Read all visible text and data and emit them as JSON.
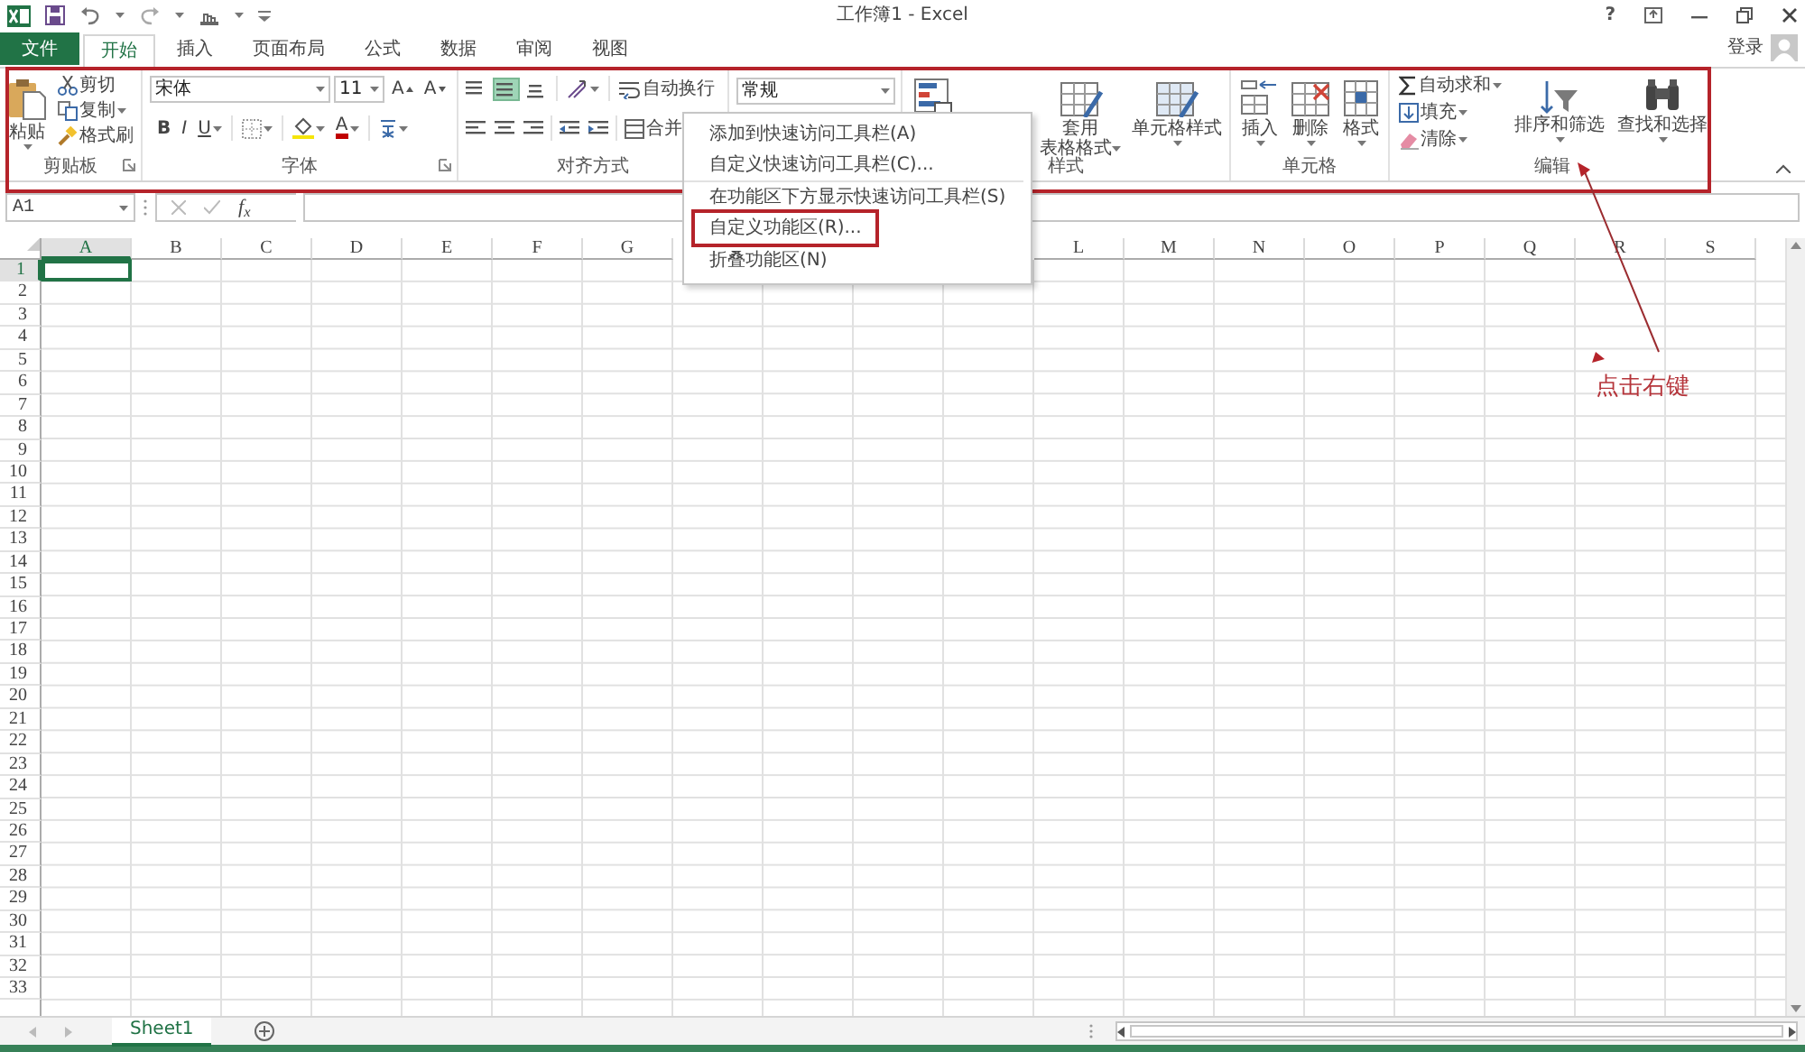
{
  "title_bar": {
    "title": "工作簿1 - Excel",
    "help": "?"
  },
  "tabs": [
    {
      "label": "文件",
      "kind": "file",
      "selected": false
    },
    {
      "label": "开始",
      "kind": "tab",
      "selected": true
    },
    {
      "label": "插入",
      "kind": "tab",
      "selected": false
    },
    {
      "label": "页面布局",
      "kind": "tab",
      "selected": false
    },
    {
      "label": "公式",
      "kind": "tab",
      "selected": false
    },
    {
      "label": "数据",
      "kind": "tab",
      "selected": false
    },
    {
      "label": "审阅",
      "kind": "tab",
      "selected": false
    },
    {
      "label": "视图",
      "kind": "tab",
      "selected": false
    }
  ],
  "account": {
    "sign_in": "登录"
  },
  "ribbon": {
    "clipboard": {
      "label": "剪贴板",
      "paste": "粘贴",
      "cut": "剪切",
      "copy": "复制",
      "format_painter": "格式刷"
    },
    "font": {
      "label": "字体",
      "font_name": "宋体",
      "font_size": "11",
      "grow": "A",
      "shrink": "A",
      "bold": "B",
      "italic": "I",
      "underline": "U",
      "font_color": "A"
    },
    "alignment": {
      "label": "对齐方式",
      "vertical": [
        {
          "kind": "top",
          "selected": false
        },
        {
          "kind": "middle",
          "selected": true
        },
        {
          "kind": "bottom",
          "selected": false
        }
      ],
      "wrap_text": "自动换行",
      "merge": "合并"
    },
    "number": {
      "format": "常规"
    },
    "styles": {
      "label": "样式",
      "format_as_table": [
        "套用",
        "表格格式"
      ],
      "cell_styles": "单元格样式"
    },
    "cells": {
      "label": "单元格",
      "insert": "插入",
      "delete": "删除",
      "format": "格式"
    },
    "editing": {
      "label": "编辑",
      "autosum": "自动求和",
      "fill": "填充",
      "clear": "清除",
      "sort_filter": "排序和筛选",
      "find_select": "查找和选择"
    }
  },
  "formula_bar": {
    "name_box": "A1",
    "function_label": "f$_{x}$"
  },
  "grid": {
    "columns_left": [
      {
        "label": "A",
        "selected": true
      },
      {
        "label": "B",
        "selected": false
      },
      {
        "label": "C",
        "selected": false
      },
      {
        "label": "D",
        "selected": false
      },
      {
        "label": "E",
        "selected": false
      },
      {
        "label": "F",
        "selected": false
      },
      {
        "label": "G",
        "selected": false
      }
    ],
    "columns_right": [
      {
        "label": "L",
        "selected": false
      },
      {
        "label": "M",
        "selected": false
      },
      {
        "label": "N",
        "selected": false
      },
      {
        "label": "O",
        "selected": false
      },
      {
        "label": "P",
        "selected": false
      },
      {
        "label": "Q",
        "selected": false
      },
      {
        "label": "R",
        "selected": false
      },
      {
        "label": "S",
        "selected": false
      }
    ],
    "rows": [
      {
        "label": "1",
        "selected": true
      },
      {
        "label": "2",
        "selected": false
      },
      {
        "label": "3",
        "selected": false
      },
      {
        "label": "4",
        "selected": false
      },
      {
        "label": "5",
        "selected": false
      },
      {
        "label": "6",
        "selected": false
      },
      {
        "label": "7",
        "selected": false
      },
      {
        "label": "8",
        "selected": false
      },
      {
        "label": "9",
        "selected": false
      },
      {
        "label": "10",
        "selected": false
      },
      {
        "label": "11",
        "selected": false
      },
      {
        "label": "12",
        "selected": false
      },
      {
        "label": "13",
        "selected": false
      },
      {
        "label": "14",
        "selected": false
      },
      {
        "label": "15",
        "selected": false
      },
      {
        "label": "16",
        "selected": false
      },
      {
        "label": "17",
        "selected": false
      },
      {
        "label": "18",
        "selected": false
      },
      {
        "label": "19",
        "selected": false
      },
      {
        "label": "20",
        "selected": false
      },
      {
        "label": "21",
        "selected": false
      },
      {
        "label": "22",
        "selected": false
      },
      {
        "label": "23",
        "selected": false
      },
      {
        "label": "24",
        "selected": false
      },
      {
        "label": "25",
        "selected": false
      },
      {
        "label": "26",
        "selected": false
      },
      {
        "label": "27",
        "selected": false
      },
      {
        "label": "28",
        "selected": false
      },
      {
        "label": "29",
        "selected": false
      },
      {
        "label": "30",
        "selected": false
      },
      {
        "label": "31",
        "selected": false
      },
      {
        "label": "32",
        "selected": false
      },
      {
        "label": "33",
        "selected": false
      }
    ]
  },
  "sheet_tabs": [
    {
      "label": "Sheet1",
      "selected": true
    }
  ],
  "context_menu": [
    {
      "label": "添加到快速访问工具栏(A)",
      "marked": false
    },
    {
      "label": "自定义快速访问工具栏(C)...",
      "marked": false
    },
    {
      "label": "在功能区下方显示快速访问工具栏(S)",
      "marked": false
    },
    {
      "label": "自定义功能区(R)...",
      "marked": true
    },
    {
      "label": "折叠功能区(N)",
      "marked": false
    }
  ],
  "annotation": {
    "text": "点击右键"
  }
}
